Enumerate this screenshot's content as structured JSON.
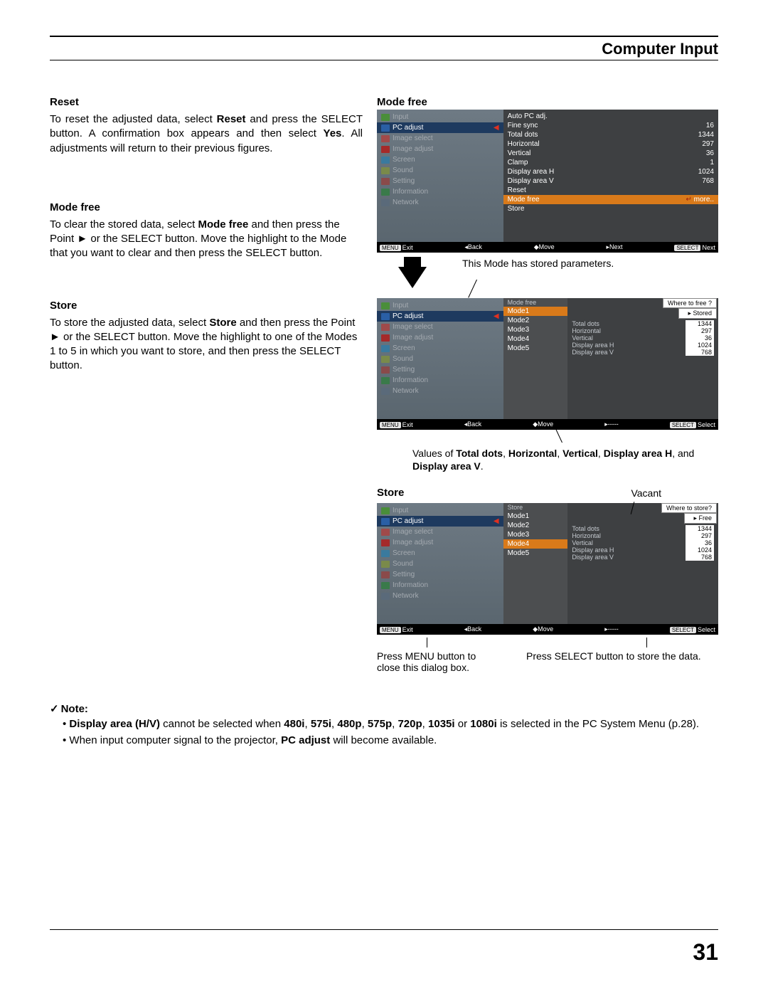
{
  "header": {
    "title": "Computer Input"
  },
  "left": {
    "reset": {
      "title": "Reset",
      "p1a": "To reset the adjusted data, select ",
      "p1b": "Reset",
      "p1c": " and press the SELECT button. A confirmation box appears and then select ",
      "p1d": "Yes",
      "p1e": ". All adjustments will return to their previous figures."
    },
    "modefree": {
      "title": "Mode free",
      "p1a": "To clear the stored data, select ",
      "p1b": "Mode free",
      "p1c": " and then press the Point ► or the SELECT button. Move the highlight to the Mode that you want to clear and then press the SELECT button."
    },
    "store": {
      "title": "Store",
      "p1a": "To store the adjusted data, select ",
      "p1b": "Store",
      "p1c": " and then press the Point ► or the SELECT button. Move the highlight to one of the Modes 1 to 5 in which you want to store, and then press the SELECT button."
    }
  },
  "right": {
    "modefree_label": "Mode free",
    "store_label": "Store",
    "vacant_label": "Vacant",
    "stored_annotation": "This Mode has stored parameters.",
    "values_annotation_a": "Values of ",
    "values_annotation_b1": "Total dots",
    "values_annotation_b2": "Horizontal",
    "values_annotation_b3": "Vertical",
    "values_annotation_b4": "Display area H",
    "values_annotation_b5": "Display area V",
    "values_annotation_c": ", and ",
    "values_annotation_d": ".",
    "press_menu": "Press MENU button to close this dialog box.",
    "press_select": "Press SELECT button to store the data."
  },
  "sidebar_items": [
    {
      "name": "Input",
      "icon": "i1"
    },
    {
      "name": "PC adjust",
      "icon": "i2",
      "active": true
    },
    {
      "name": "Image select",
      "icon": "i3"
    },
    {
      "name": "Image adjust",
      "icon": "i4"
    },
    {
      "name": "Screen",
      "icon": "i5"
    },
    {
      "name": "Sound",
      "icon": "i6"
    },
    {
      "name": "Setting",
      "icon": "i7"
    },
    {
      "name": "Information",
      "icon": "i8"
    },
    {
      "name": "Network",
      "icon": "i9"
    }
  ],
  "menu1": {
    "rows": [
      {
        "label": "Auto PC adj.",
        "val": ""
      },
      {
        "label": "Fine sync",
        "val": "16"
      },
      {
        "label": "Total dots",
        "val": "1344"
      },
      {
        "label": "Horizontal",
        "val": "297"
      },
      {
        "label": "Vertical",
        "val": "36"
      },
      {
        "label": "Clamp",
        "val": "1"
      },
      {
        "label": "Display area H",
        "val": "1024"
      },
      {
        "label": "Display area V",
        "val": "768"
      },
      {
        "label": "Reset",
        "val": ""
      }
    ],
    "highlight": {
      "label": "Mode free",
      "val": "more..",
      "icon": "↵"
    },
    "after": [
      {
        "label": "Store",
        "val": ""
      }
    ],
    "footer": [
      "Exit",
      "◂Back",
      "◆Move",
      "▸Next",
      "Next"
    ]
  },
  "menu2": {
    "header_left": "Mode free",
    "header_q": "Where to free ?",
    "header_status": "Stored",
    "modes": [
      "Mode1",
      "Mode2",
      "Mode3",
      "Mode4",
      "Mode5"
    ],
    "highlight_index": 0,
    "data_rows": [
      {
        "label": "Total dots",
        "val": "1344"
      },
      {
        "label": "Horizontal",
        "val": "297"
      },
      {
        "label": "Vertical",
        "val": "36"
      },
      {
        "label": "Display area H",
        "val": "1024"
      },
      {
        "label": "Display area V",
        "val": "768"
      }
    ],
    "footer": [
      "Exit",
      "◂Back",
      "◆Move",
      "▸-----",
      "Select"
    ]
  },
  "menu3": {
    "header_left": "Store",
    "header_q": "Where to store?",
    "header_status": "Free",
    "modes": [
      "Mode1",
      "Mode2",
      "Mode3",
      "Mode4",
      "Mode5"
    ],
    "highlight_index": 3,
    "data_rows": [
      {
        "label": "Total dots",
        "val": "1344"
      },
      {
        "label": "Horizontal",
        "val": "297"
      },
      {
        "label": "Vertical",
        "val": "36"
      },
      {
        "label": "Display area H",
        "val": "1024"
      },
      {
        "label": "Display area V",
        "val": "768"
      }
    ],
    "footer": [
      "Exit",
      "◂Back",
      "◆Move",
      "▸-----",
      "Select"
    ]
  },
  "note": {
    "title": "Note:",
    "li1a": "Display area (H/V)",
    "li1b": " cannot be selected when ",
    "li1c": "480i",
    "li1d": ", ",
    "li1e": "575i",
    "li1f": "480p",
    "li1g": "575p",
    "li1h": "720p",
    "li1i": "1035i",
    "li1j": " or ",
    "li1k": "1080i",
    "li1l": " is selected in the PC System Menu (p.28).",
    "li2a": "When input computer signal to the projector, ",
    "li2b": "PC adjust",
    "li2c": " will become available."
  },
  "footer_btn": {
    "menu": "MENU",
    "select": "SELECT"
  },
  "page_number": "31"
}
